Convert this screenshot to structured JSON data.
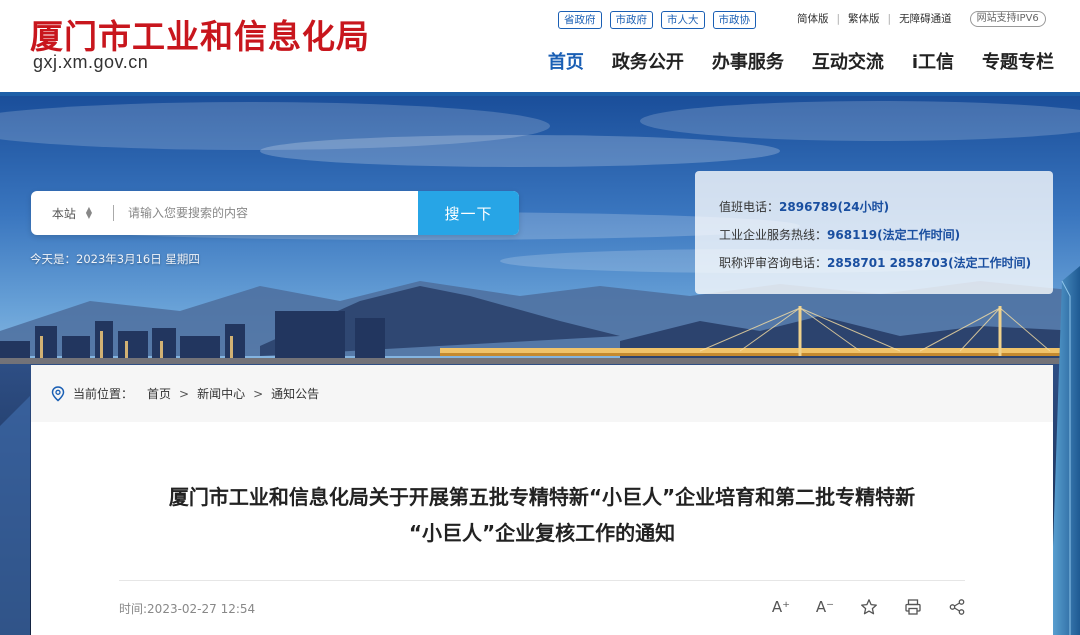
{
  "header": {
    "title": "厦门市工业和信息化局",
    "domain": "gxj.xm.gov.cn",
    "gov_links": [
      "省政府",
      "市政府",
      "市人大",
      "市政协"
    ],
    "util_links": [
      "简体版",
      "繁体版",
      "无障碍通道"
    ],
    "ipv6": "网站支持IPV6",
    "nav": [
      "首页",
      "政务公开",
      "办事服务",
      "互动交流",
      "i工信",
      "专题专栏"
    ]
  },
  "search": {
    "scope": "本站",
    "placeholder": "请输入您要搜索的内容",
    "button": "搜一下"
  },
  "date_text": "今天是：2023年3月16日 星期四",
  "hotlines": [
    {
      "label": "值班电话：",
      "number": "2896789(24小时)"
    },
    {
      "label": "工业企业服务热线：",
      "number": "968119(法定工作时间)"
    },
    {
      "label": "职称评审咨询电话：",
      "number": "2858701 2858703(法定工作时间)"
    }
  ],
  "breadcrumb": {
    "prefix": "当前位置：",
    "items": [
      "首页",
      "新闻中心",
      "通知公告"
    ],
    "separator": ">"
  },
  "article": {
    "title_line1": "厦门市工业和信息化局关于开展第五批专精特新“小巨人”企业培育和第二批专精特新",
    "title_line2": "“小巨人”企业复核工作的通知",
    "time": "时间:2023-02-27 12:54"
  },
  "tools": {
    "font_up": "A⁺",
    "font_down": "A⁻"
  },
  "colors": {
    "brand_red": "#c8161d",
    "nav_active": "#1a5fb4",
    "search_button": "#27a5e6",
    "hotline_number": "#1a4fa0"
  }
}
